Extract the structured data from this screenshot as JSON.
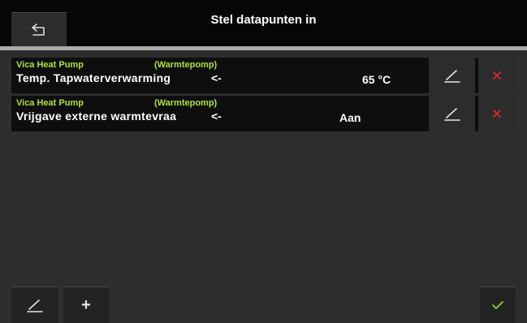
{
  "header": {
    "title": "Stel datapunten in",
    "back_icon": "back-arrow-icon"
  },
  "colors": {
    "device_label": "#aee33a",
    "delete_red": "#e0282e",
    "confirm_green": "#8fd12e",
    "divider": "#a9a9a9"
  },
  "datapoints": [
    {
      "device": "Vica Heat Pump",
      "type": "(Warmtepomp)",
      "name": "Temp. Tapwaterverwarming",
      "direction": "<-",
      "value": "65 °C"
    },
    {
      "device": "Vica Heat Pump",
      "type": "(Warmtepomp)",
      "name": "Vrijgave externe warmtevraa",
      "direction": "<-",
      "value": "Aan"
    }
  ],
  "toolbar": {
    "edit_icon": "pencil-icon",
    "add_label": "+",
    "confirm_icon": "checkmark-icon"
  }
}
